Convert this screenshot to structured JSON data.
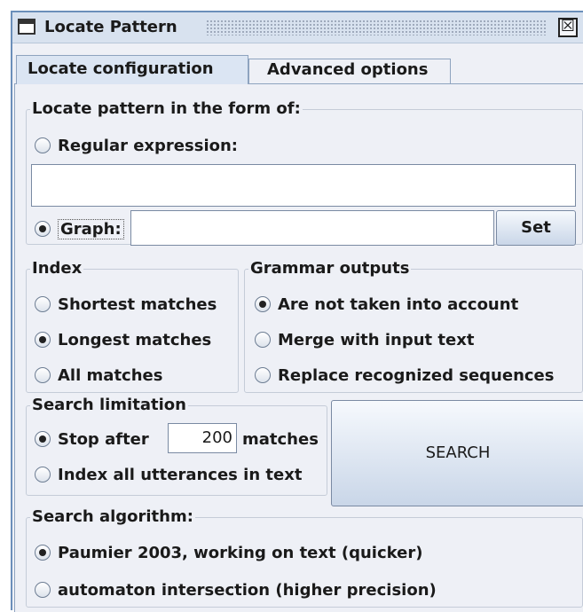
{
  "window": {
    "title": "Locate Pattern",
    "close_symbol": "☒"
  },
  "tabs": [
    {
      "label": "Locate configuration",
      "active": true
    },
    {
      "label": "Advanced options",
      "active": false
    }
  ],
  "locate_pattern": {
    "legend": "Locate pattern in the form of:",
    "regex_label": "Regular expression:",
    "regex_selected": false,
    "regex_value": "",
    "graph_label": "Graph:",
    "graph_selected": true,
    "graph_value": "",
    "set_button": "Set"
  },
  "index": {
    "legend": "Index",
    "options": [
      {
        "label": "Shortest matches",
        "selected": false
      },
      {
        "label": "Longest matches",
        "selected": true
      },
      {
        "label": "All matches",
        "selected": false
      }
    ]
  },
  "grammar_outputs": {
    "legend": "Grammar outputs",
    "options": [
      {
        "label": "Are not taken into account",
        "selected": true
      },
      {
        "label": "Merge with input text",
        "selected": false
      },
      {
        "label": "Replace recognized sequences",
        "selected": false
      }
    ]
  },
  "search_limitation": {
    "legend": "Search limitation",
    "stop_after_label": "Stop after",
    "stop_after_selected": true,
    "stop_after_value": "200",
    "matches_label": "matches",
    "index_all_label": "Index all utterances in text",
    "index_all_selected": false
  },
  "search_button": "SEARCH",
  "search_algorithm": {
    "legend": "Search algorithm:",
    "options": [
      {
        "label": "Paumier 2003, working on text (quicker)",
        "selected": true
      },
      {
        "label": "automaton intersection (higher precision)",
        "selected": false
      }
    ]
  }
}
